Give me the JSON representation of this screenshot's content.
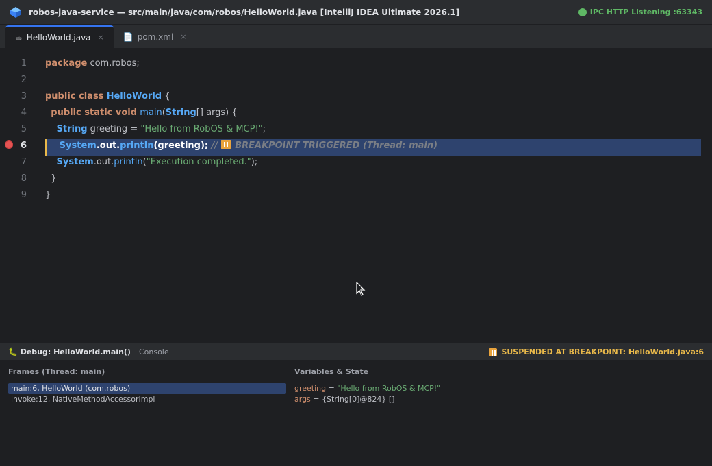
{
  "window": {
    "title": "robos-java-service — src/main/java/com/robos/HelloWorld.java [IntelliJ IDEA Ultimate 2026.1]",
    "ipc_status": "IPC HTTP Listening :63343",
    "app_icon": "intellij-logo-icon",
    "ipc_icon": "green-status-dot-icon"
  },
  "tabs": [
    {
      "label": "HelloWorld.java",
      "icon": "java-file-icon",
      "close": "×",
      "active": true
    },
    {
      "label": "pom.xml",
      "icon": "xml-file-icon",
      "close": "×",
      "active": false
    }
  ],
  "editor": {
    "line_numbers": [
      "1",
      "2",
      "3",
      "4",
      "5",
      "6",
      "7",
      "8",
      "9"
    ],
    "current_line": "6",
    "breakpoint_line": "6",
    "lines": {
      "l1": {
        "kw": "package",
        "rest": " com.robos;"
      },
      "l3": {
        "kw": "public class",
        "cls": "HelloWorld",
        "rest": " {"
      },
      "l4": {
        "kw": "public static void",
        "fn": "main",
        "open": "(",
        "cls": "String",
        "rest": "[] args) {"
      },
      "l5": {
        "cls": "String",
        "mid": " greeting = ",
        "str": "\"Hello from RobOS & MCP!\"",
        "end": ";"
      },
      "l6": {
        "cls": "System",
        "dot1": ".out.",
        "fn": "println",
        "rest": "(greeting);",
        "comment_prefix": " // ",
        "comment": " BREAKPOINT TRIGGERED (Thread: main)"
      },
      "l7": {
        "cls": "System",
        "mid": ".out.",
        "fn": "println",
        "open": "(",
        "str": "\"Execution completed.\"",
        "end": ");"
      },
      "l8": {
        "rest": "}"
      },
      "l9": {
        "rest": "}"
      }
    }
  },
  "debug": {
    "tab_label": "Debug: HelloWorld.main()",
    "console_label": "Console",
    "status": "SUSPENDED AT BREAKPOINT: HelloWorld.java:6",
    "frames_title": "Frames (Thread: main)",
    "frames": [
      "main:6, HelloWorld (com.robos)",
      "invoke:12, NativeMethodAccessorImpl"
    ],
    "vars_title": "Variables & State",
    "variables": [
      {
        "name": "greeting",
        "eq": " = ",
        "value": "\"Hello from RobOS & MCP!\""
      },
      {
        "name": "args",
        "eq": " = ",
        "value": "{String[0]@824} []"
      }
    ]
  },
  "colors": {
    "accent": "#3574f0",
    "breakpoint": "#e55353",
    "suspended": "#e8b84a",
    "ipc_green": "#5fb865",
    "highlight": "#2e436e"
  }
}
